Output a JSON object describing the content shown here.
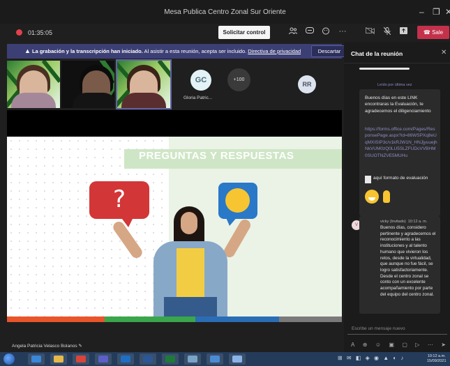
{
  "window": {
    "title": "Mesa Publica Centro Zonal Sur Oriente",
    "controls": [
      "–",
      "❐",
      "✕"
    ]
  },
  "toolbar": {
    "timer": "01:35:05",
    "request_control": "Solicitar control",
    "leave": "Sale",
    "icons": [
      "participants-icon",
      "chat-icon",
      "reactions-icon",
      "more-icon",
      "camera-off-icon",
      "mic-off-icon",
      "share-icon"
    ]
  },
  "notice": {
    "bold": "La grabación y la transcripción han iniciado.",
    "text": " Al asistir a esta reunión, acepta ser incluido. ",
    "link": "Directiva de privacidad",
    "dismiss": "Descartar"
  },
  "participants": {
    "gc_initials": "GC",
    "gc_name": "Gloria Patric...",
    "more": "+100",
    "rr_initials": "RR"
  },
  "slide": {
    "title": "PREGUNTAS Y RESPUESTAS",
    "question_mark": "?",
    "bars": [
      "#e8552b",
      "#3aa64b",
      "#2a6db5",
      "#7a7a7a"
    ]
  },
  "presenter": {
    "name": "Angela Patricia Velasco Bolanos"
  },
  "chat": {
    "title": "Chat de la reunión",
    "read_label": "Leído por última vez",
    "msg1_text": "Buenos días en este LINK encontraras la Evaluación, te agradecemos el diligenciamiento",
    "msg1_url": "https://forms.office.com/Pages/ResponsePage.aspx?id=86WSPXq8eUqMXISIP3c/v1kRJW1N_HNJjyuuejhNkVUM0zQ0LU5SLZFUDcVVBHM0SUOTNZVE5MUHu",
    "msg1_file": "aquí formato de evaluación",
    "msg2_author": "vicky (Invitado)",
    "msg2_time": "10:12 a. m.",
    "msg2_avatar": "V",
    "msg2_text": "Buenos días, considero pertinente y agradecemos el reconocimiento a las instituciones y al talento humano que vivieron los retos, desde la virtualidad, que aunque no fue fácil, se logro satisfactoriamente. Desde el centro zonal se conto con un excelente acompañamiento por parte del equipo del centro zonal.",
    "input_placeholder": "Escribe un mensaje nuevo"
  },
  "taskbar": {
    "time": "10:12 a.m.",
    "date": "15/09/2021"
  }
}
